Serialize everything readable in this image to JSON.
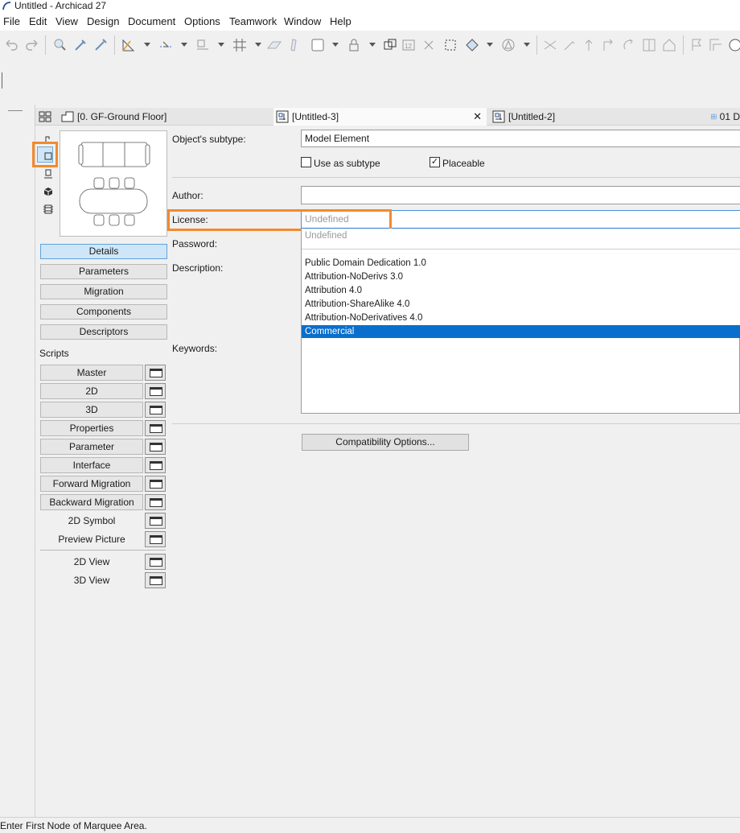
{
  "window": {
    "title": "Untitled - Archicad 27"
  },
  "menu": [
    "File",
    "Edit",
    "View",
    "Design",
    "Document",
    "Options",
    "Teamwork",
    "Window",
    "Help"
  ],
  "tabs": [
    {
      "label": "[0. GF-Ground Floor]",
      "icon": "floor-plan-icon"
    },
    {
      "label": "[Untitled-3]",
      "icon": "object-editor-icon",
      "active": true,
      "closable": true
    },
    {
      "label": "[Untitled-2]",
      "icon": "object-editor-icon"
    },
    {
      "label": "01 D",
      "icon": "grid-icon"
    }
  ],
  "side_buttons": [
    "Details",
    "Parameters",
    "Migration",
    "Components",
    "Descriptors"
  ],
  "scripts_label": "Scripts",
  "scripts": [
    "Master",
    "2D",
    "3D",
    "Properties",
    "Parameter",
    "Interface",
    "Forward Migration",
    "Backward Migration",
    "2D Symbol",
    "Preview Picture"
  ],
  "views": [
    "2D View",
    "3D View"
  ],
  "form": {
    "subtype_label": "Object's subtype:",
    "subtype_value": "Model Element",
    "use_as_subtype_label": "Use as subtype",
    "use_as_subtype_checked": false,
    "placeable_label": "Placeable",
    "placeable_checked": true,
    "author_label": "Author:",
    "author_value": "",
    "license_label": "License:",
    "license_value": "Undefined",
    "password_label": "Password:",
    "description_label": "Description:",
    "keywords_label": "Keywords:",
    "compat_button": "Compatibility Options..."
  },
  "license_options": [
    {
      "label": "Undefined",
      "disabled": true
    },
    {
      "label": "Public Domain Dedication 1.0"
    },
    {
      "label": "Attribution-NoDerivs 3.0"
    },
    {
      "label": "Attribution 4.0"
    },
    {
      "label": "Attribution-ShareAlike 4.0"
    },
    {
      "label": "Attribution-NoDerivatives 4.0"
    },
    {
      "label": "Commercial",
      "selected": true
    }
  ],
  "status": "Enter First Node of Marquee Area.",
  "colors": {
    "highlight": "#f28a2e",
    "selection": "#0a6fcc"
  }
}
